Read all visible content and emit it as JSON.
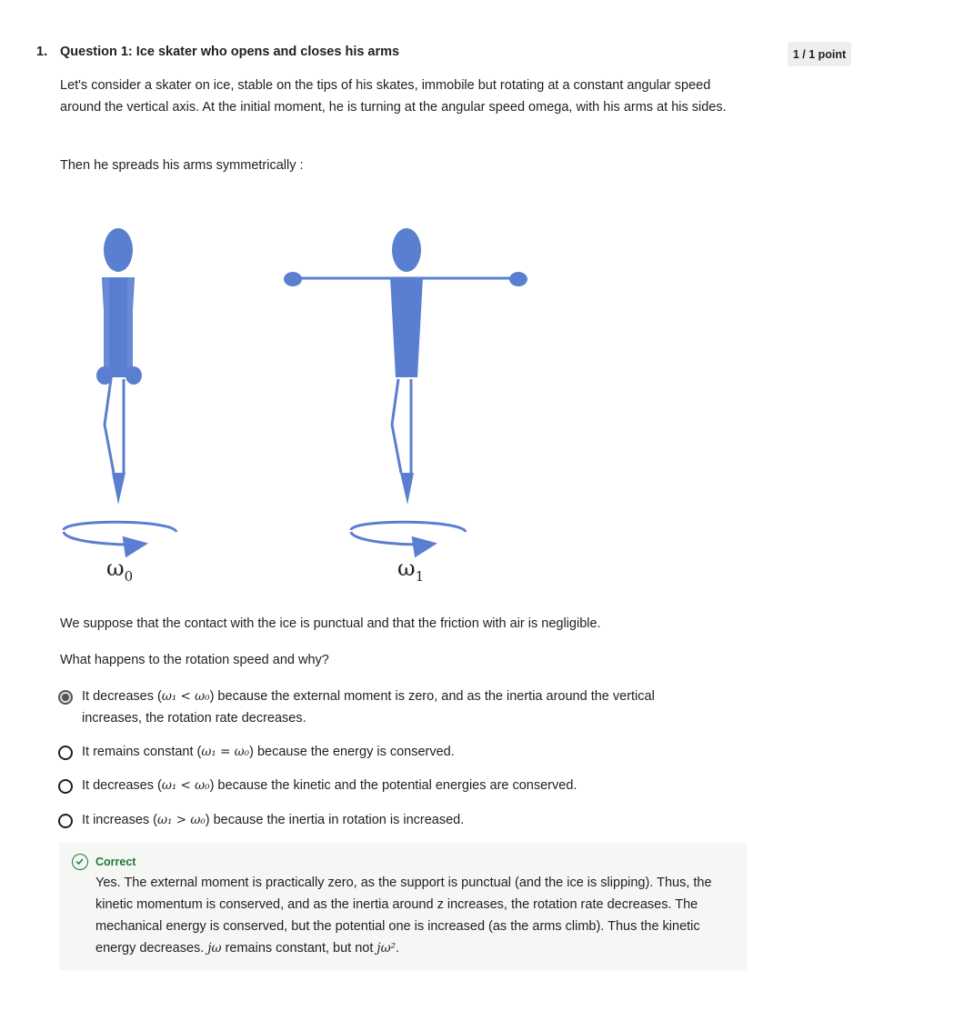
{
  "question": {
    "number": "1.",
    "title": "Question 1: Ice skater who opens and closes his arms",
    "points": "1 / 1 point",
    "intro": "Let's consider a skater on ice, stable on the tips of his skates, immobile but rotating at a constant angular speed around the vertical axis. At the initial moment, he is turning at the angular speed omega, with his arms at his sides.",
    "then": "Then he spreads his arms symmetrically :",
    "figure": {
      "label_left_symbol": "ω",
      "label_left_sub": "0",
      "label_right_symbol": "ω",
      "label_right_sub": "1",
      "color": "#5b7fd0"
    },
    "assumption": "We suppose that the contact with the ice is punctual and that the friction with air is negligible.",
    "prompt": "What happens to the rotation speed and why?"
  },
  "options": [
    {
      "pre": "It decreases (",
      "math": "ω₁ < ω₀",
      "post": ") because the external moment is zero, and as the inertia around the vertical increases, the rotation rate decreases.",
      "selected": true
    },
    {
      "pre": "It remains constant (",
      "math": "ω₁ = ω₀",
      "post": ") because the energy is conserved.",
      "selected": false
    },
    {
      "pre": "It decreases (",
      "math": "ω₁ < ω₀",
      "post": ") because the kinetic and the potential energies are conserved.",
      "selected": false
    },
    {
      "pre": "It increases (",
      "math": "ω₁ > ω₀",
      "post": ") because the inertia in rotation is increased.",
      "selected": false
    }
  ],
  "feedback": {
    "status": "Correct",
    "text": "Yes. The external moment is practically zero, as the support is punctual (and the ice is slipping). Thus, the kinetic momentum is conserved, and as the inertia around z increases, the rotation rate decreases. The mechanical energy is conserved, but the potential one is increased (as the arms climb). Thus the kinetic energy decreases.",
    "math1": "jω",
    "mid": "remains constant, but not",
    "math2": "jω²",
    "end": ".",
    "accent": "#1e7a35"
  }
}
